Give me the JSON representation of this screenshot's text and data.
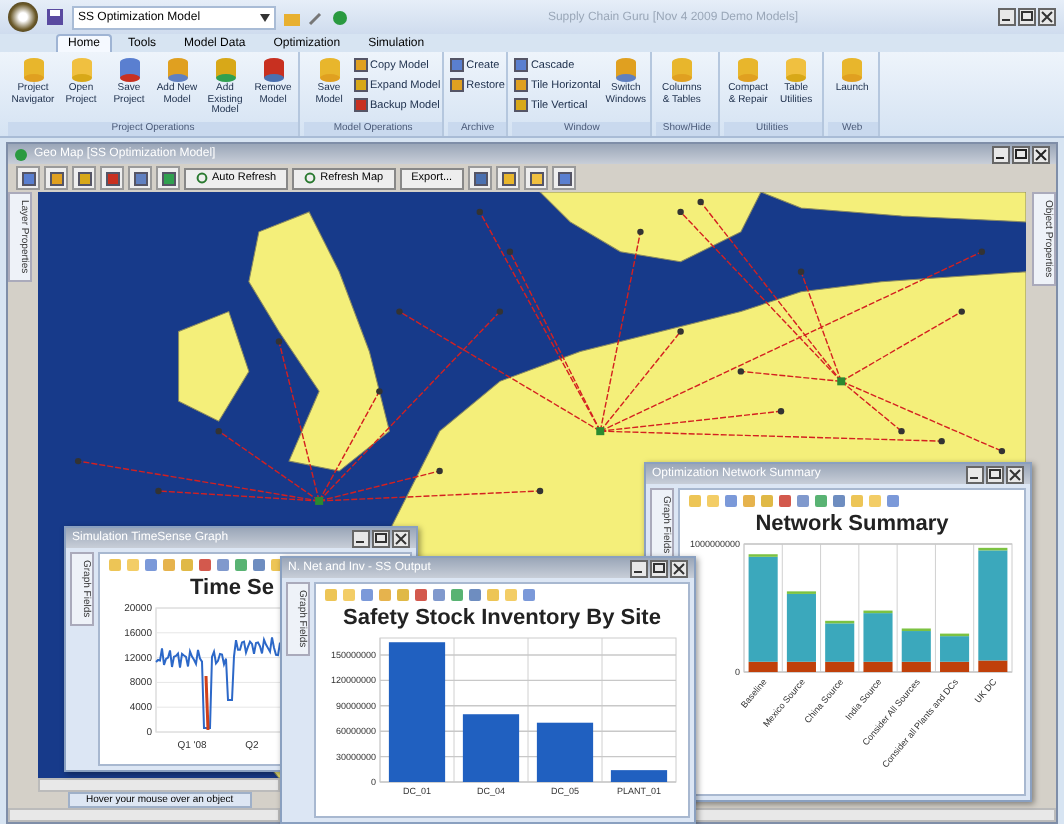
{
  "app": {
    "model_selector": "SS Optimization Model",
    "title": "Supply Chain Guru [Nov 4 2009 Demo Models]"
  },
  "ribbon_tabs": [
    {
      "label": "Home",
      "selected": true
    },
    {
      "label": "Tools",
      "selected": false
    },
    {
      "label": "Model Data",
      "selected": false
    },
    {
      "label": "Optimization",
      "selected": false
    },
    {
      "label": "Simulation",
      "selected": false
    }
  ],
  "ribbon_groups": [
    {
      "name": "Project Operations",
      "items": [
        {
          "label": "Project Navigator",
          "kind": "large"
        },
        {
          "label": "Open Project",
          "kind": "large"
        },
        {
          "label": "Save Project",
          "kind": "large"
        },
        {
          "label": "Add New Model",
          "kind": "large"
        },
        {
          "label": "Add Existing Model",
          "kind": "large"
        },
        {
          "label": "Remove Model",
          "kind": "large"
        }
      ]
    },
    {
      "name": "Model Operations",
      "items": [
        {
          "label": "Save Model",
          "kind": "large"
        },
        {
          "label": "Copy Model",
          "kind": "small"
        },
        {
          "label": "Expand Model",
          "kind": "small"
        },
        {
          "label": "Backup Model",
          "kind": "small"
        }
      ]
    },
    {
      "name": "Archive",
      "items": [
        {
          "label": "Create",
          "kind": "small"
        },
        {
          "label": "Restore",
          "kind": "small"
        }
      ]
    },
    {
      "name": "Window",
      "items": [
        {
          "label": "Cascade",
          "kind": "small"
        },
        {
          "label": "Tile Horizontal",
          "kind": "small"
        },
        {
          "label": "Tile Vertical",
          "kind": "small"
        },
        {
          "label": "Switch Windows",
          "kind": "large"
        }
      ]
    },
    {
      "name": "Show/Hide",
      "items": [
        {
          "label": "Columns & Tables",
          "kind": "large"
        }
      ]
    },
    {
      "name": "Utilities",
      "items": [
        {
          "label": "Compact & Repair",
          "kind": "large"
        },
        {
          "label": "Table Utilities",
          "kind": "large"
        }
      ]
    },
    {
      "name": "Web",
      "items": [
        {
          "label": "Launch",
          "kind": "large"
        }
      ]
    }
  ],
  "geo_map": {
    "title": "Geo Map [SS Optimization Model]",
    "toolbar_buttons": [
      "Auto Refresh",
      "Refresh Map",
      "Export..."
    ],
    "left_panel": "Layer Properties",
    "right_panel": "Object Properties",
    "status": "Hover your mouse over an object"
  },
  "windows": [
    {
      "kind": "bar_chart",
      "title": "Optimization Network Summary",
      "side_tab": "Graph Fields",
      "chart_data": {
        "type": "bar",
        "title": "Network Summary",
        "stacked": true,
        "grid": true,
        "categories": [
          "Baseline",
          "Mexico Source",
          "China Source",
          "India Source",
          "Consider All Sources",
          "Consider all Plants and DCs",
          "UK DC"
        ],
        "yticks": [
          0,
          1000000000
        ],
        "ylim": [
          0,
          1000000000
        ],
        "series": [
          {
            "color": "#c0400a",
            "values": [
              80000000,
              80000000,
              80000000,
              80000000,
              80000000,
              80000000,
              90000000
            ]
          },
          {
            "color": "#3ba8bc",
            "values": [
              820000000,
              530000000,
              300000000,
              380000000,
              240000000,
              200000000,
              860000000
            ]
          },
          {
            "color": "#7cc242",
            "values": [
              20000000,
              20000000,
              20000000,
              20000000,
              20000000,
              20000000,
              20000000
            ]
          }
        ]
      }
    },
    {
      "kind": "line_picture",
      "title": "Simulation TimeSense Graph",
      "side_tab": "Graph Fields",
      "chart_title": "Time Se",
      "y_labels": [
        "20000",
        "16000",
        "12000",
        "8000",
        "4000",
        "0"
      ],
      "x_labels": [
        "Q1 '08",
        "Q2"
      ]
    },
    {
      "kind": "bar_chart",
      "title": "N. Net and Inv - SS Output",
      "side_tab": "Graph Fields",
      "chart_data": {
        "type": "bar",
        "title": "Safety Stock Inventory By Site",
        "grid": true,
        "categories": [
          "DC_01",
          "DC_04",
          "DC_05",
          "PLANT_01"
        ],
        "yticks": [
          0,
          30000000,
          60000000,
          90000000,
          120000000,
          150000000
        ],
        "ylim": [
          0,
          170000000
        ],
        "series": [
          {
            "color": "#2060c0",
            "values": [
              165000000,
              80000000,
              70000000,
              14000000
            ]
          }
        ]
      }
    }
  ]
}
